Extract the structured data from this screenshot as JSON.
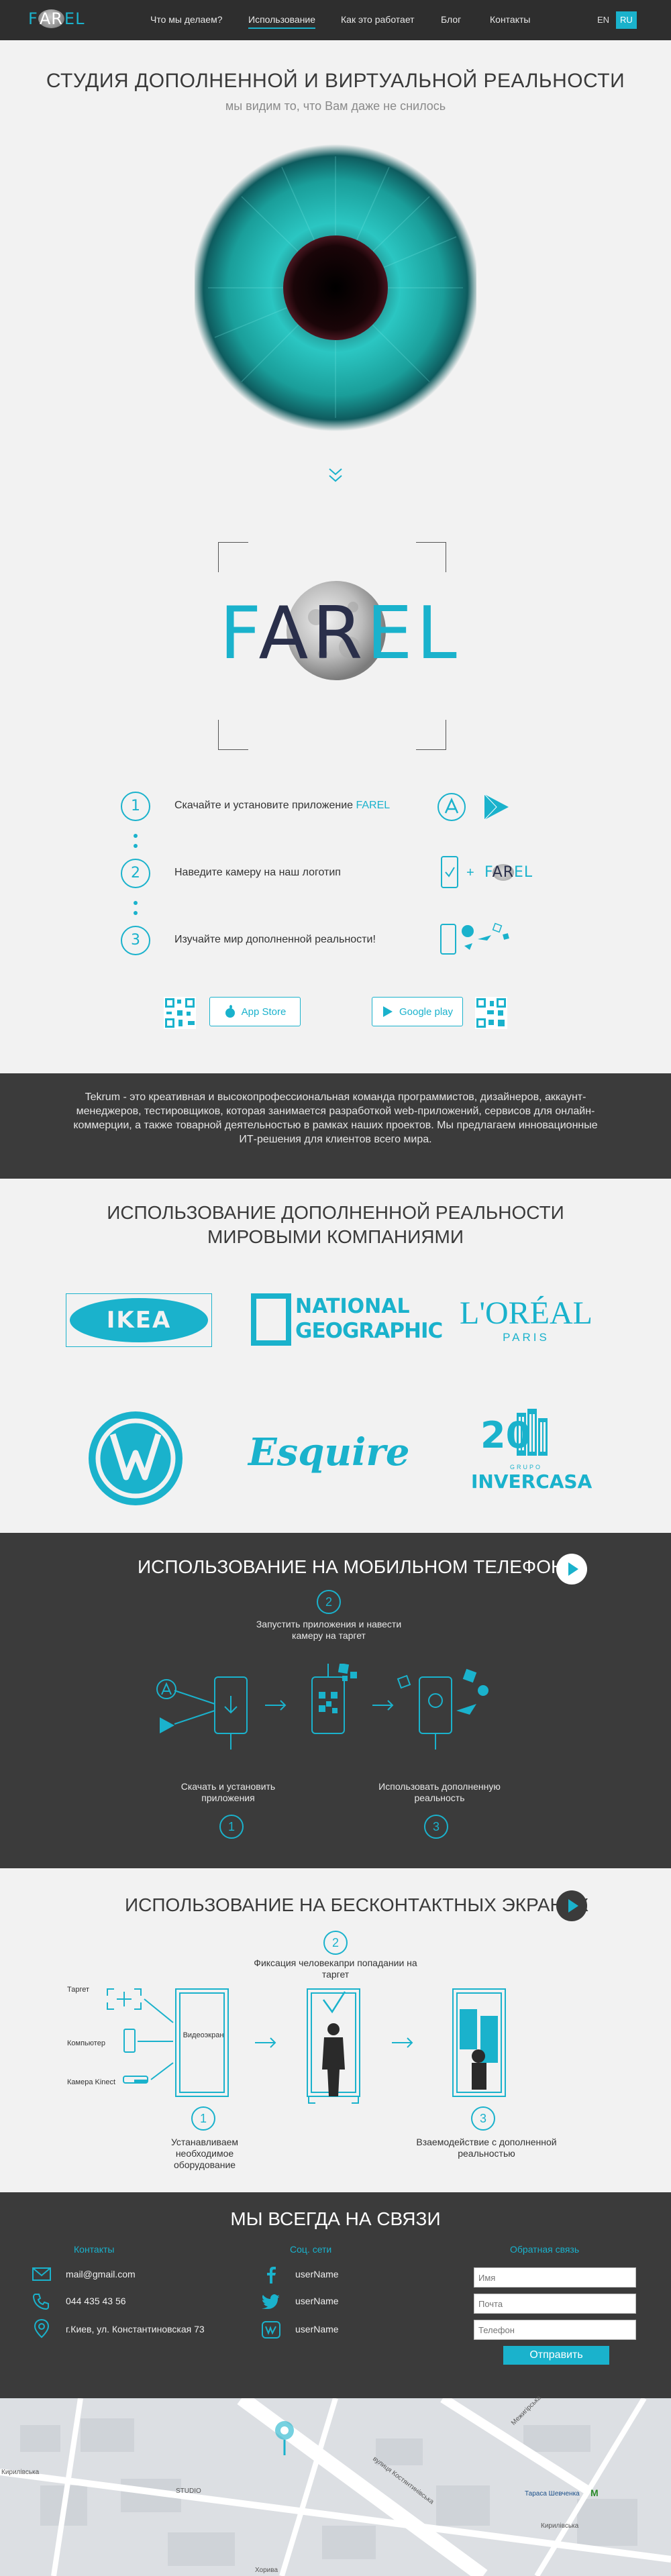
{
  "nav": {
    "logo_pre": "F",
    "logo_ar": "AR",
    "logo_post": "EL",
    "items": [
      {
        "label": "Что мы делаем?"
      },
      {
        "label": "Использование"
      },
      {
        "label": "Как это работает"
      },
      {
        "label": "Блог"
      },
      {
        "label": "Контакты"
      }
    ],
    "lang_en": "EN",
    "lang_ru": "RU"
  },
  "hero": {
    "title": "СТУДИЯ ДОПОЛНЕННОЙ И ВИРТУАЛЬНОЙ РЕАЛЬНОСТИ",
    "subtitle": "мы видим то, что Вам даже не снилось"
  },
  "big_logo": {
    "pre": "F",
    "ar": "AR",
    "post": "EL"
  },
  "steps": [
    {
      "num": "1",
      "text": "Скачайте и установите приложение ",
      "highlight": "FAREL"
    },
    {
      "num": "2",
      "text": "Наведите камеру на наш логотип"
    },
    {
      "num": "3",
      "text": "Изучайте мир дополненной реальности!"
    }
  ],
  "step2_plus": "+",
  "step2_logo": {
    "pre": "F",
    "ar": "AR",
    "post": "EL"
  },
  "stores": {
    "appstore": "App Store",
    "googleplay": "Google play"
  },
  "about": {
    "text": "Tekrum - это креативная и высокопрофессиональная команда программистов, дизайнеров, аккаунт-менеджеров, тестировщиков, которая занимается разработкой web-приложений, сервисов для онлайн-коммерции, а также товарной деятельностью в рамках наших проектов. Мы предлагаем инновационные ИТ-решения для клиентов всего мира."
  },
  "companies": {
    "title_line1": "ИСПОЛЬЗОВАНИЕ ДОПОЛНЕННОЙ РЕАЛЬНОСТИ",
    "title_line2": "МИРОВЫМИ КОМПАНИЯМИ",
    "logos": {
      "ikea": "IKEA",
      "natgeo_1": "NATIONAL",
      "natgeo_2": "GEOGRAPHIC",
      "loreal": "L'ORÉAL",
      "loreal_sub": "PARIS",
      "esquire": "Esquire",
      "invercasa_num": "20",
      "invercasa_sub": "GRUPO",
      "invercasa": "INVERCASA"
    }
  },
  "mobile": {
    "title": "ИСПОЛЬЗОВАНИЕ НА МОБИЛЬНОМ ТЕЛЕФОНЕ",
    "step2_num": "2",
    "step2_text": "Запустить приложения и навести камеру на таргет",
    "step1_text": "Скачать и установить приложения",
    "step1_num": "1",
    "step3_text": "Использовать дополненную реальность",
    "step3_num": "3"
  },
  "screens": {
    "title": "ИСПОЛЬЗОВАНИЕ НА БЕСКОНТАКТНЫХ ЭКРАНАХ",
    "step2_num": "2",
    "step2_text": "Фиксация человекапри попадании на таргет",
    "label_target": "Таргет",
    "label_computer": "Компьютер",
    "label_kinect": "Камера Kinect",
    "label_screen": "Видеоэкран",
    "step1_num": "1",
    "step1_text": "Устанавливаем необходимое оборудование",
    "step3_num": "3",
    "step3_text": "Взаемодействие с дополненной реальностью"
  },
  "contact": {
    "title": "МЫ ВСЕГДА НА СВЯЗИ",
    "col1_head": "Контакты",
    "email": "mail@gmail.com",
    "phone": "044 435 43 56",
    "address": "г.Киев, ул. Константиновская 73",
    "col2_head": "Соц. сети",
    "fb": "userName",
    "tw": "userName",
    "vk": "userName",
    "col3_head": "Обратная связь",
    "name_ph": "Имя",
    "mail_ph": "Почта",
    "phone_ph": "Телефон",
    "send": "Отправить"
  },
  "map": {
    "street1": "вулиця Костянтинівська",
    "street2": "Межигірська",
    "metro": "Тараса Шевченка",
    "label_left": "Кирилівська",
    "label_mid": "STUDIO",
    "label_right": "Кирилівська",
    "label_bottom": "Хорива",
    "metro_letter": "M"
  },
  "colors": {
    "accent": "#1ab2cc",
    "dark": "#3b3b3b",
    "nav": "#2e2e2e"
  }
}
